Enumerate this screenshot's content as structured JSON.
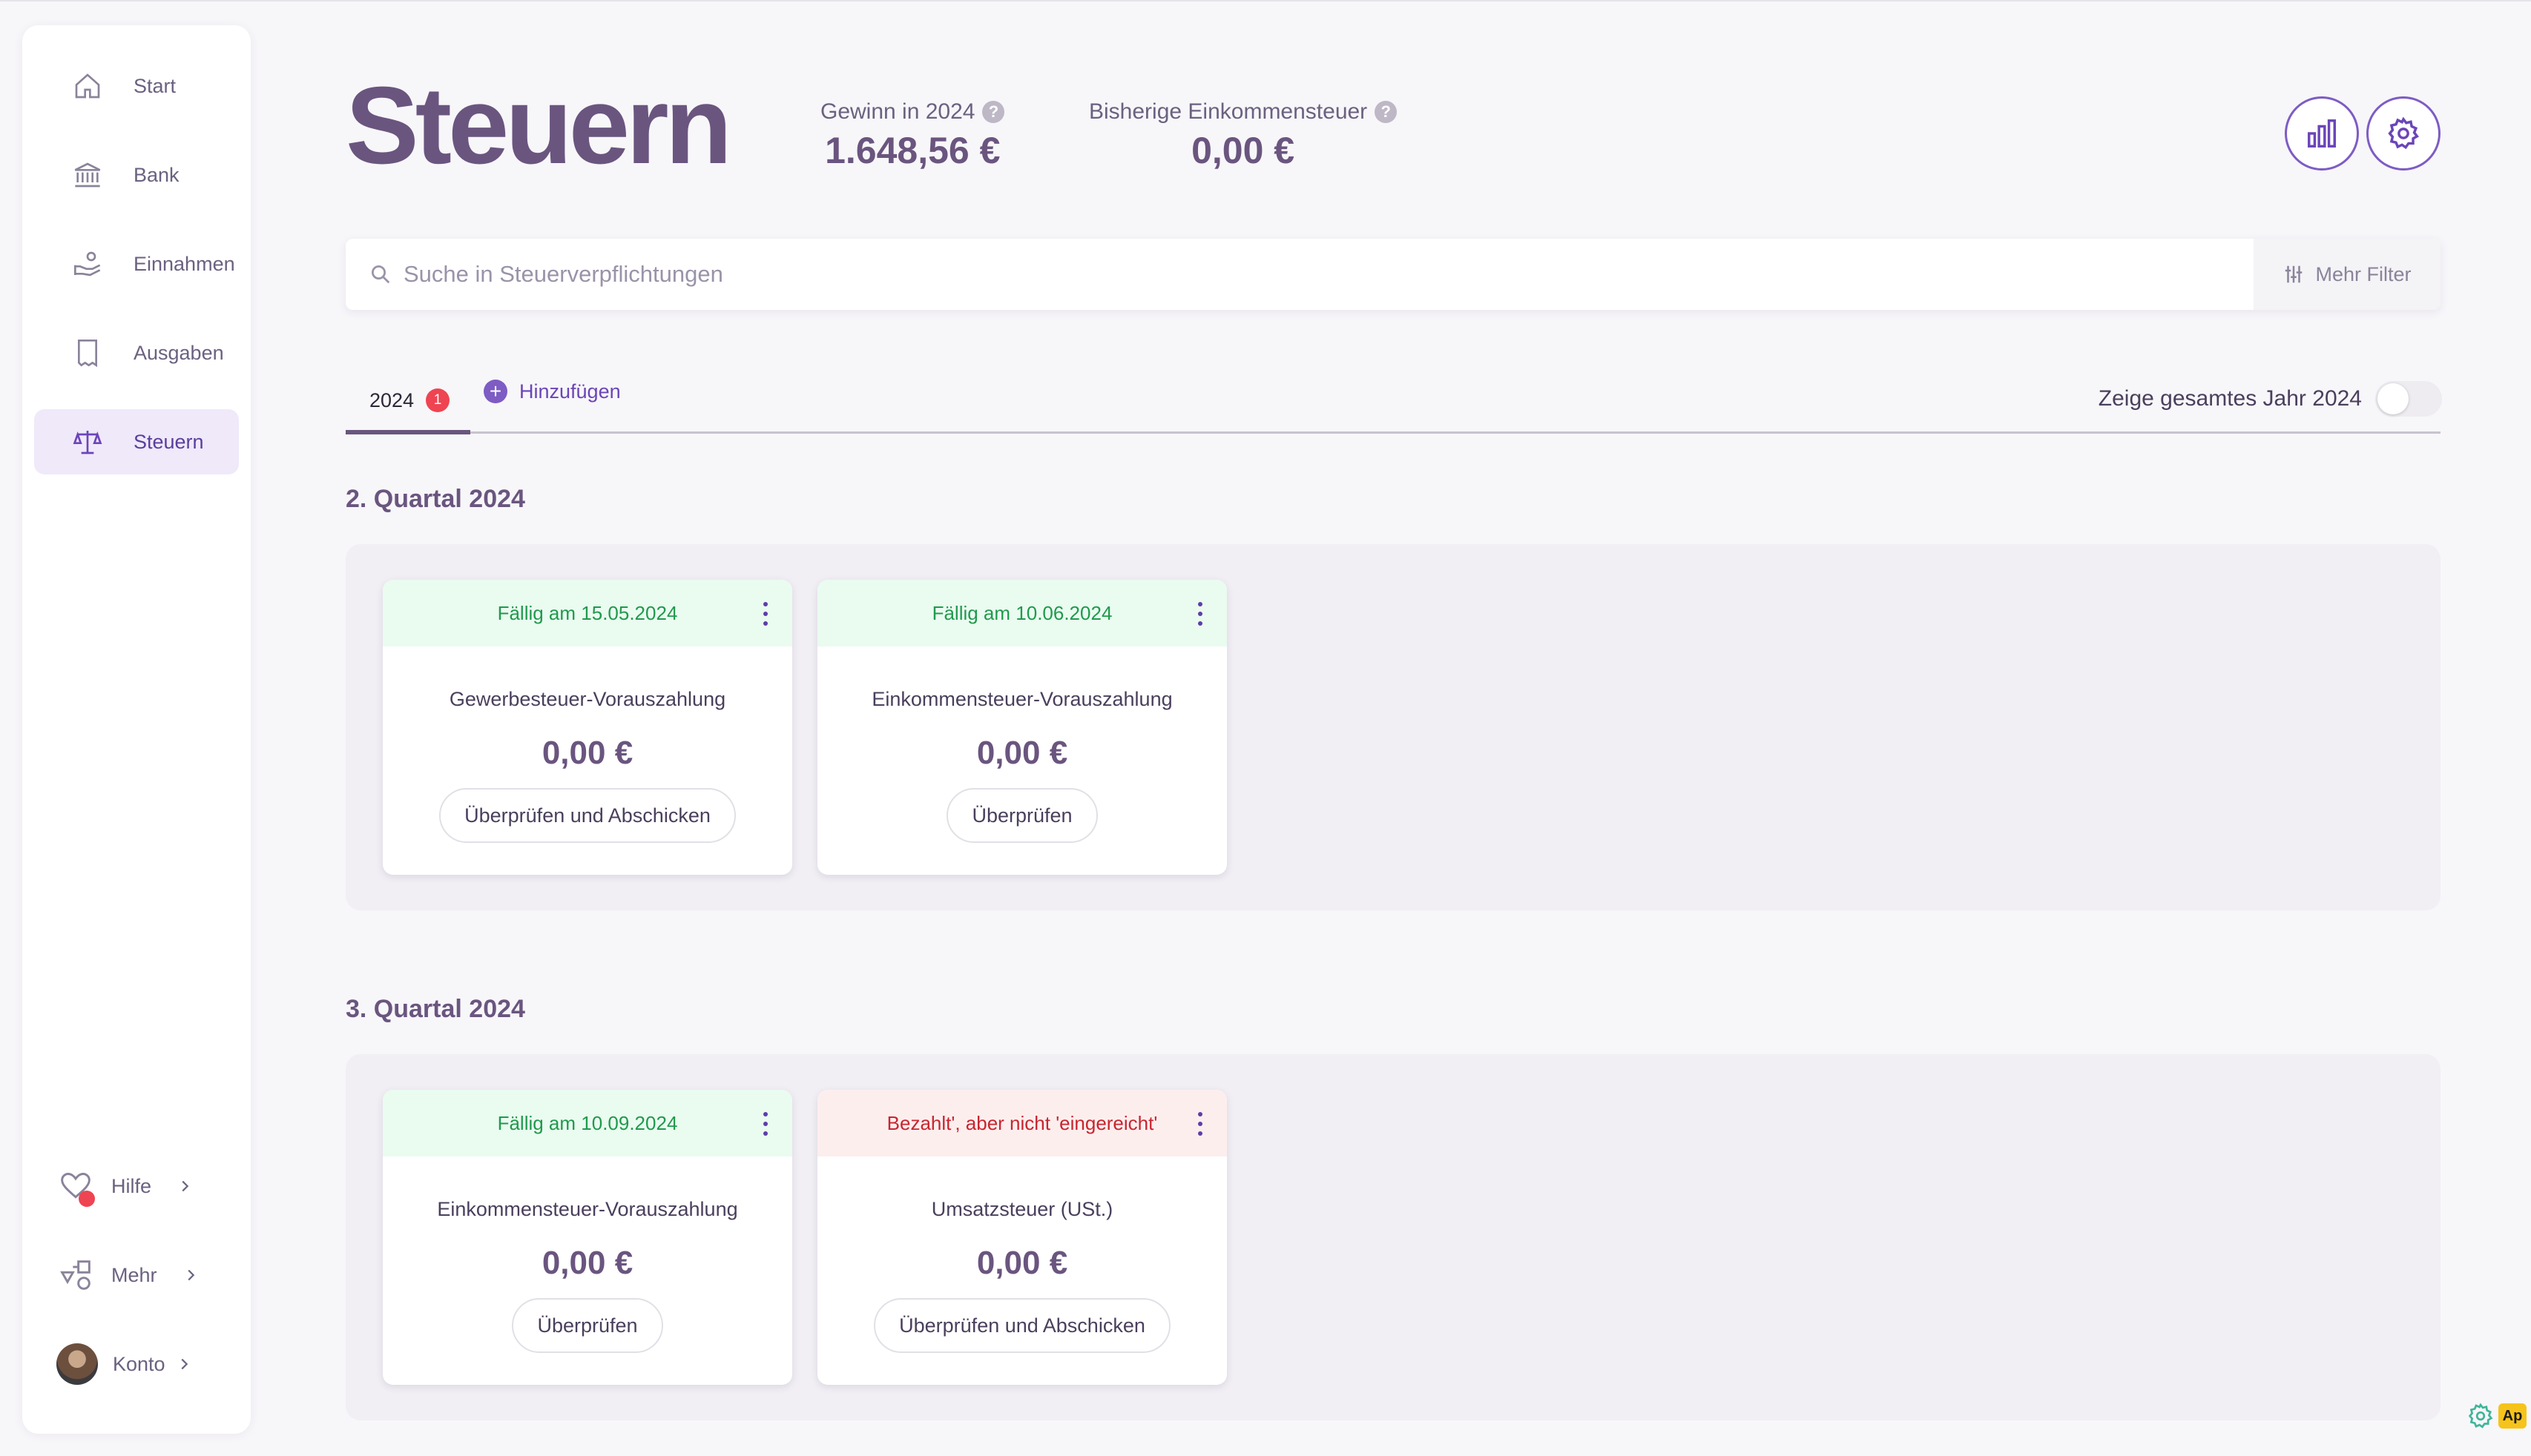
{
  "sidebar": {
    "items": [
      {
        "label": "Start",
        "icon": "home-icon"
      },
      {
        "label": "Bank",
        "icon": "bank-icon"
      },
      {
        "label": "Einnahmen",
        "icon": "hand-coins-icon"
      },
      {
        "label": "Ausgaben",
        "icon": "receipt-icon"
      },
      {
        "label": "Steuern",
        "icon": "scales-icon",
        "active": true
      }
    ],
    "bottom": [
      {
        "label": "Hilfe",
        "icon": "heart-icon"
      },
      {
        "label": "Mehr",
        "icon": "shapes-icon"
      },
      {
        "label": "Konto",
        "icon": "avatar"
      }
    ]
  },
  "header": {
    "title": "Steuern",
    "profit_label": "Gewinn in 2024",
    "profit_value": "1.648,56 €",
    "income_tax_label": "Bisherige Einkommensteuer",
    "income_tax_value": "0,00 €",
    "help_glyph": "?"
  },
  "search": {
    "placeholder": "Suche in Steuerverpflichtungen",
    "value": "",
    "filter_label": "Mehr Filter"
  },
  "tabs": {
    "year_label": "2024",
    "year_badge": "1",
    "add_label": "Hinzufügen",
    "add_glyph": "+",
    "toggle_label": "Zeige gesamtes Jahr 2024",
    "toggle_on": false
  },
  "quarters": [
    {
      "title": "2. Quartal 2024",
      "cards": [
        {
          "status": "Fällig am 15.05.2024",
          "status_color": "#1f9a4c",
          "type": "Gewerbesteuer-Vorauszahlung",
          "amount": "0,00 €",
          "button": "Überprüfen und Abschicken"
        },
        {
          "status": "Fällig am 10.06.2024",
          "status_color": "#1f9a4c",
          "type": "Einkommensteuer-Vorauszahlung",
          "amount": "0,00 €",
          "button": "Überprüfen"
        }
      ]
    },
    {
      "title": "3. Quartal 2024",
      "cards": [
        {
          "status": "Fällig am 10.09.2024",
          "status_color": "#1f9a4c",
          "type": "Einkommensteuer-Vorauszahlung",
          "amount": "0,00 €",
          "button": "Überprüfen"
        },
        {
          "status": "Bezahlt', aber nicht 'eingereicht'",
          "status_color": "#c8252f",
          "type": "Umsatzsteuer (USt.)",
          "amount": "0,00 €",
          "button": "Überprüfen und Abschicken"
        }
      ]
    }
  ],
  "corner_widget": {
    "badge": "Ap"
  },
  "colors": {
    "accent": "#6a557f",
    "brand_purple": "#7d5cc4",
    "due_green": "#1f9a4c",
    "alert_red": "#c8252f"
  }
}
